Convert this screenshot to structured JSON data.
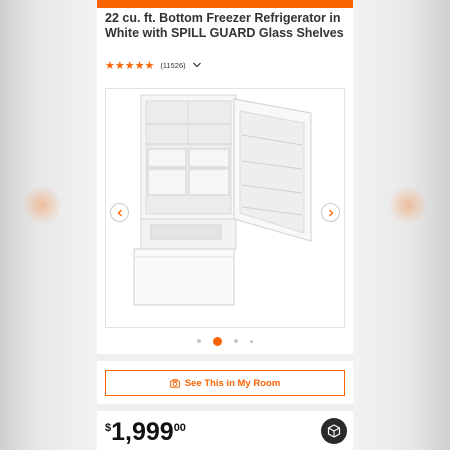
{
  "product": {
    "title": "22 cu. ft. Bottom Freezer Refrigerator in White with SPILL GUARD Glass Shelves",
    "rating_stars": "★★★★★",
    "rating_value": 4.5,
    "rating_max": 5,
    "review_count": "(11526)"
  },
  "gallery": {
    "image_subject": "white bottom-freezer refrigerator with right door open and freezer drawer partly pulled out",
    "dot_count": 4,
    "active_index": 1
  },
  "actions": {
    "room_button_label": "See This in My Room"
  },
  "pricing": {
    "currency_symbol": "$",
    "dollars": "1,999",
    "cents": "00"
  },
  "icons": {
    "rating_toggle": "chevron-down-icon",
    "prev": "chevron-left-icon",
    "next": "chevron-right-icon",
    "room_button": "camera-icon",
    "ar_button": "ar-cube-icon"
  },
  "colors": {
    "accent": "#f96302",
    "text": "#333333",
    "ar_button_bg": "#2a2a2a"
  }
}
